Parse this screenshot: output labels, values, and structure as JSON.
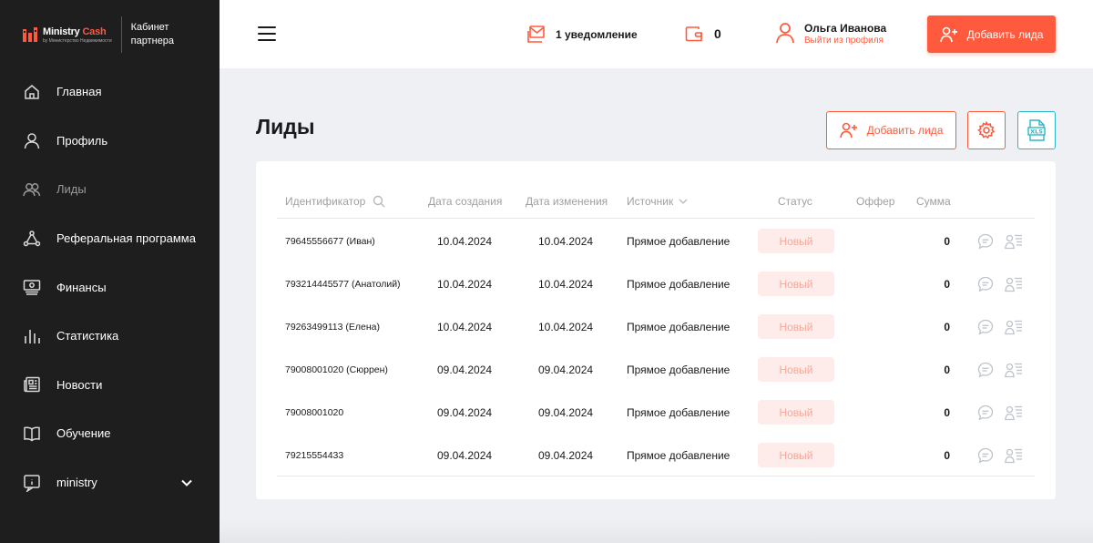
{
  "brand": {
    "name_part1": "Ministry",
    "name_part2": "Cash",
    "subtitle": "by Министерство Недвижимости",
    "cabinet": "Кабинет партнера"
  },
  "sidebar": {
    "items": [
      {
        "label": "Главная",
        "icon": "home-icon"
      },
      {
        "label": "Профиль",
        "icon": "user-icon"
      },
      {
        "label": "Лиды",
        "icon": "users-icon"
      },
      {
        "label": "Реферальная программа",
        "icon": "network-icon"
      },
      {
        "label": "Финансы",
        "icon": "money-icon"
      },
      {
        "label": "Статистика",
        "icon": "bar-chart-icon"
      },
      {
        "label": "Новости",
        "icon": "newspaper-icon"
      },
      {
        "label": "Обучение",
        "icon": "book-icon"
      },
      {
        "label": "ministry",
        "icon": "info-icon"
      }
    ],
    "active": "Лиды"
  },
  "header": {
    "notifications": "1 уведомление",
    "balance": "0",
    "user_name": "Ольга Иванова",
    "logout": "Выйти из профиля",
    "add_lead": "Добавить лида"
  },
  "main": {
    "title": "Лиды",
    "add_lead": "Добавить лида",
    "columns": [
      "Идентификатор",
      "Дата создания",
      "Дата изменения",
      "Источник",
      "Статус",
      "Оффер",
      "Сумма"
    ],
    "rows": [
      {
        "id": "79645556677 (Иван)",
        "created": "10.04.2024",
        "updated": "10.04.2024",
        "source": "Прямое добавление",
        "status": "Новый",
        "offer": "",
        "sum": "0"
      },
      {
        "id": "793214445577 (Анатолий)",
        "created": "10.04.2024",
        "updated": "10.04.2024",
        "source": "Прямое добавление",
        "status": "Новый",
        "offer": "",
        "sum": "0"
      },
      {
        "id": "79263499113 (Елена)",
        "created": "10.04.2024",
        "updated": "10.04.2024",
        "source": "Прямое добавление",
        "status": "Новый",
        "offer": "",
        "sum": "0"
      },
      {
        "id": "79008001020 (Сюррен)",
        "created": "09.04.2024",
        "updated": "09.04.2024",
        "source": "Прямое добавление",
        "status": "Новый",
        "offer": "",
        "sum": "0"
      },
      {
        "id": "79008001020",
        "created": "09.04.2024",
        "updated": "09.04.2024",
        "source": "Прямое добавление",
        "status": "Новый",
        "offer": "",
        "sum": "0"
      },
      {
        "id": "79215554433",
        "created": "09.04.2024",
        "updated": "09.04.2024",
        "source": "Прямое добавление",
        "status": "Новый",
        "offer": "",
        "sum": "0"
      }
    ]
  },
  "colors": {
    "accent": "#ff5a3d",
    "sidebar_bg": "#1e1e1e",
    "xls": "#2fb6c6",
    "status_bg": "#fdecea"
  }
}
